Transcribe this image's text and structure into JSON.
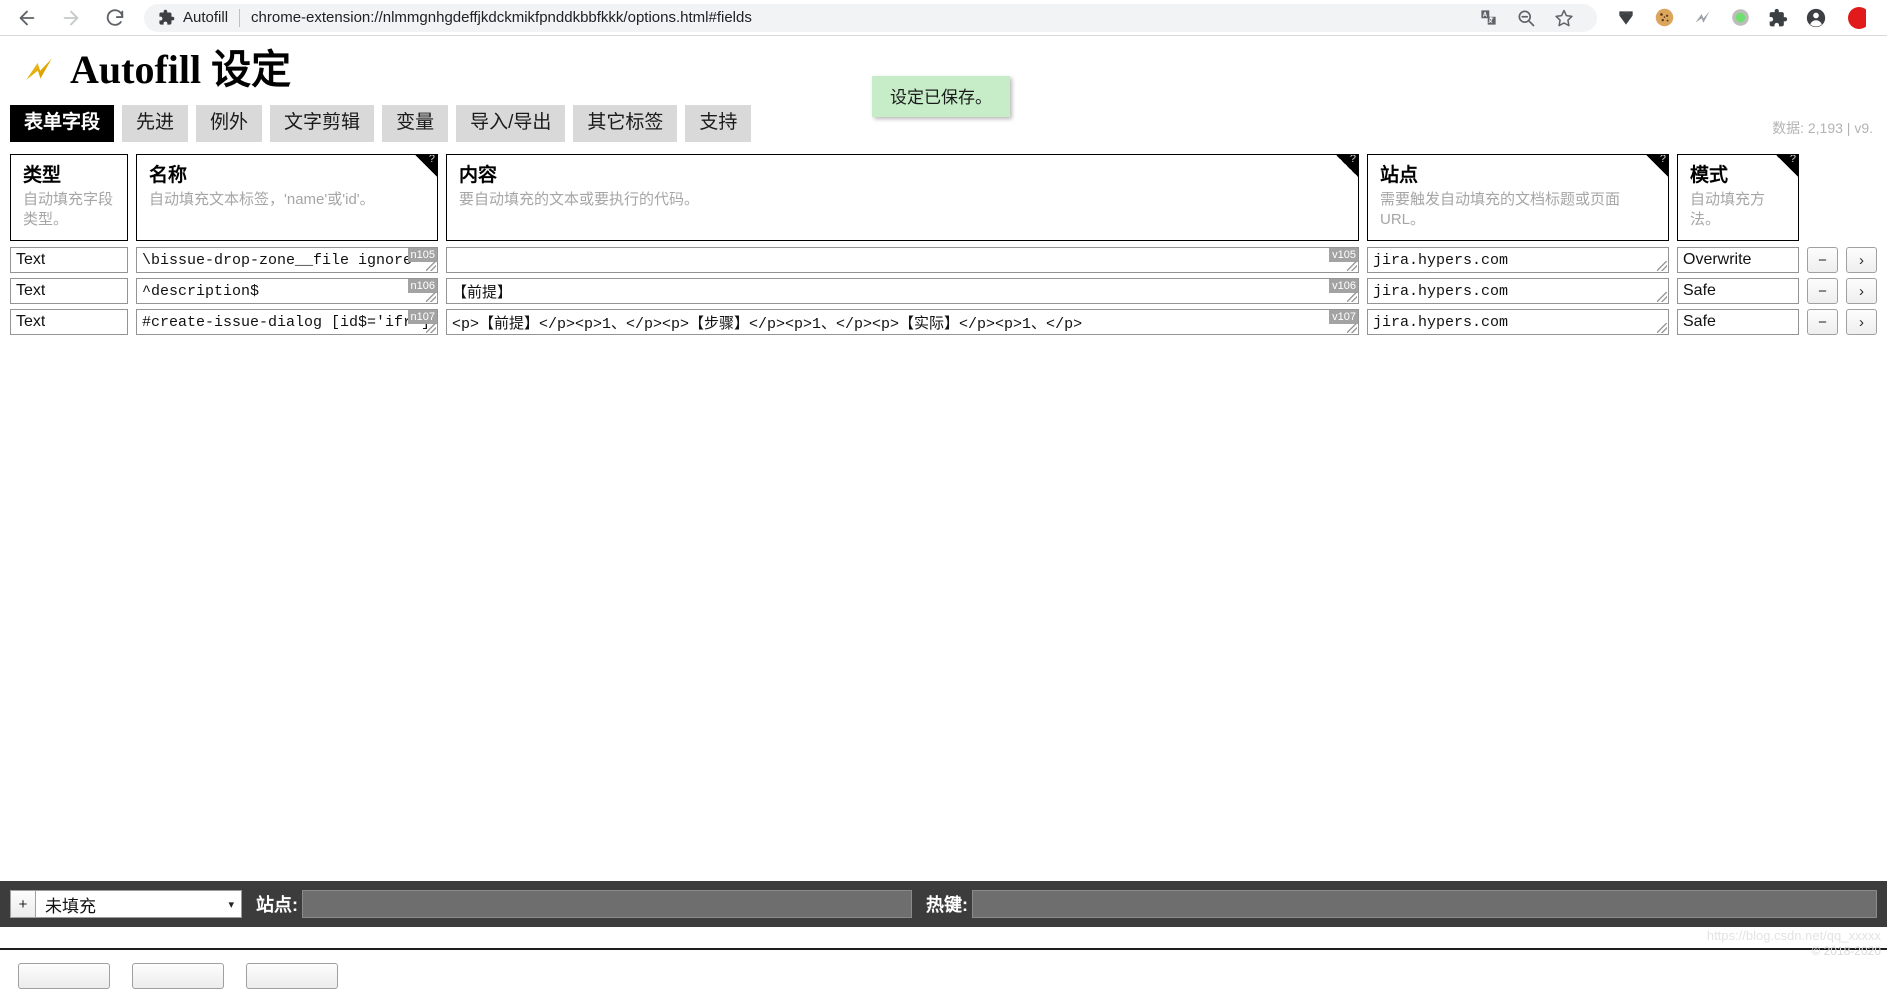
{
  "browser": {
    "back_icon": "back-arrow-icon",
    "forward_icon": "forward-arrow-icon",
    "reload_icon": "reload-icon",
    "extension_label": "Autofill",
    "url": "chrome-extension://nlmmgnhgdeffjkdckmikfpnddkbbfkkk/options.html#fields",
    "toolbar_icons": [
      {
        "name": "translate-icon",
        "glyph": "translate"
      },
      {
        "name": "zoom-out-icon",
        "glyph": "zoom-out"
      },
      {
        "name": "bookmark-star-icon",
        "glyph": "star"
      },
      {
        "name": "pointer-flag-icon",
        "glyph": "cursor"
      },
      {
        "name": "cookie-icon",
        "glyph": "cookie"
      },
      {
        "name": "autofill-bolt-icon",
        "glyph": "bolt"
      },
      {
        "name": "green-dot-extension-icon",
        "glyph": "dot"
      },
      {
        "name": "extensions-puzzle-icon",
        "glyph": "puzzle"
      },
      {
        "name": "profile-avatar-icon",
        "glyph": "avatar"
      },
      {
        "name": "red-extension-icon",
        "glyph": "red"
      }
    ]
  },
  "header": {
    "title": "Autofill 设定",
    "title_main": "Autofill",
    "title_suffix": "设定"
  },
  "toast": {
    "message": "设定已保存。"
  },
  "tabs": [
    {
      "label": "表单字段",
      "active": true
    },
    {
      "label": "先进",
      "active": false
    },
    {
      "label": "例外",
      "active": false
    },
    {
      "label": "文字剪辑",
      "active": false
    },
    {
      "label": "变量",
      "active": false
    },
    {
      "label": "导入/导出",
      "active": false
    },
    {
      "label": "其它标签",
      "active": false
    },
    {
      "label": "支持",
      "active": false
    }
  ],
  "meta": {
    "info": "数据: 2,193  |  v9."
  },
  "table": {
    "help_marker": "?",
    "columns": [
      {
        "title": "类型",
        "sub": "自动填充字段类型。",
        "has_help": false
      },
      {
        "title": "名称",
        "sub": "自动填充文本标签，'name'或'id'。",
        "has_help": true
      },
      {
        "title": "内容",
        "sub": "要自动填充的文本或要执行的代码。",
        "has_help": true
      },
      {
        "title": "站点",
        "sub": "需要触发自动填充的文档标题或页面URL。",
        "has_help": true
      },
      {
        "title": "模式",
        "sub": "自动填充方法。",
        "has_help": true
      }
    ],
    "rows": [
      {
        "type": "Text",
        "name": "\\bissue-drop-zone__file ignore-",
        "name_tag": "n105",
        "content": "",
        "content_tag": "v105",
        "site": "jira.hypers.com",
        "mode": "Overwrite",
        "remove_label": "−",
        "expand_label": "›"
      },
      {
        "type": "Text",
        "name": "^description$",
        "name_tag": "n106",
        "content": "【前提】",
        "content_tag": "v106",
        "site": "jira.hypers.com",
        "mode": "Safe",
        "remove_label": "−",
        "expand_label": "›"
      },
      {
        "type": "Text",
        "name": "#create-issue-dialog  [id$='ifr']",
        "name_tag": "n107",
        "content": "<p>【前提】</p><p>1、</p><p>【步骤】</p><p>1、</p><p>【实际】</p><p>1、</p>",
        "content_tag": "v107",
        "site": "jira.hypers.com",
        "mode": "Safe",
        "remove_label": "−",
        "expand_label": "›"
      }
    ]
  },
  "bottombar": {
    "add_label": "+",
    "type_select_value": "未填充",
    "site_label": "站点:",
    "site_value": "",
    "hotkey_label": "热键:",
    "hotkey_value": ""
  },
  "watermark": {
    "line1": "https://blog.csdn.net/qq_xxxxx",
    "line2": "© 2018-2020"
  }
}
